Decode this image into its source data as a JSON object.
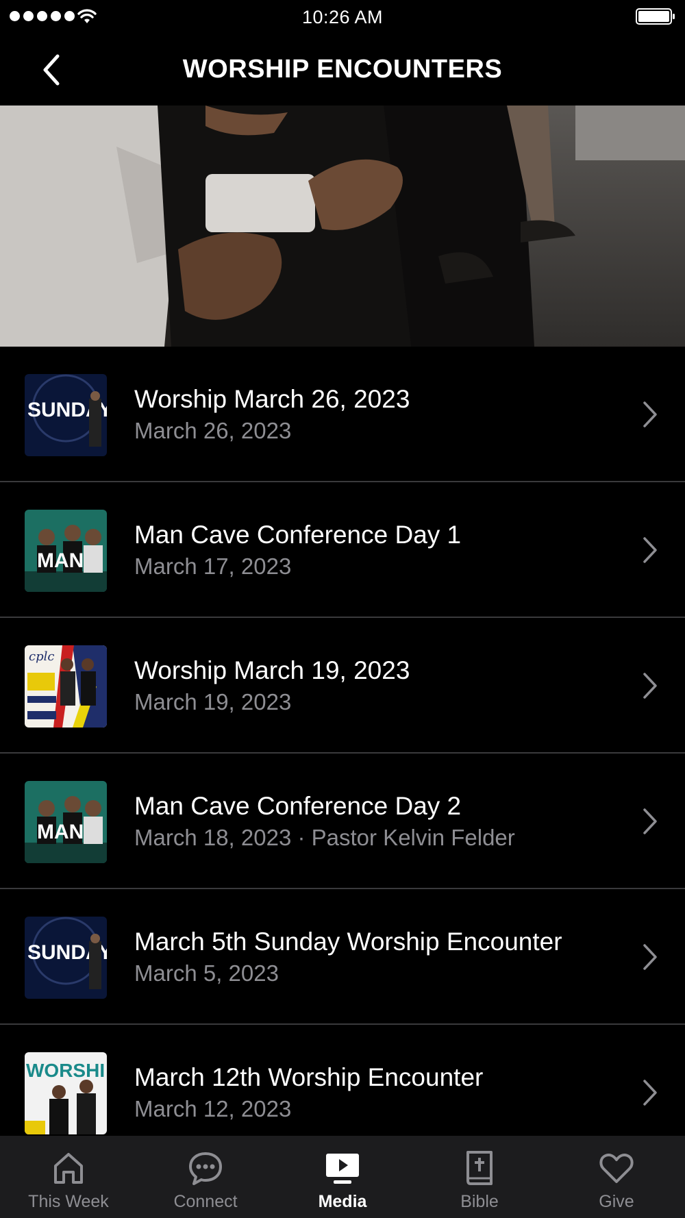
{
  "status_bar": {
    "time": "10:26 AM"
  },
  "nav": {
    "title": "WORSHIP ENCOUNTERS"
  },
  "items": [
    {
      "title": "Worship March 26, 2023",
      "subtitle": "March 26, 2023",
      "thumb_text": "SUNDAY"
    },
    {
      "title": "Man Cave Conference Day 1",
      "subtitle": "March 17, 2023",
      "thumb_text": "MAN"
    },
    {
      "title": "Worship March 19, 2023",
      "subtitle": "March 19, 2023",
      "thumb_text": "cplc"
    },
    {
      "title": "Man Cave Conference Day 2",
      "subtitle": "March 18, 2023 · Pastor Kelvin Felder",
      "thumb_text": "MAN"
    },
    {
      "title": "March 5th Sunday Worship Encounter",
      "subtitle": "March 5, 2023",
      "thumb_text": "SUNDAY"
    },
    {
      "title": "March 12th Worship Encounter",
      "subtitle": "March 12, 2023",
      "thumb_text": "WORSHI"
    }
  ],
  "tabs": [
    {
      "label": "This Week",
      "icon": "home-icon",
      "active": false
    },
    {
      "label": "Connect",
      "icon": "chat-bubble-icon",
      "active": false
    },
    {
      "label": "Media",
      "icon": "tv-play-icon",
      "active": true
    },
    {
      "label": "Bible",
      "icon": "bible-icon",
      "active": false
    },
    {
      "label": "Give",
      "icon": "heart-icon",
      "active": false
    }
  ],
  "colors": {
    "background": "#000000",
    "tab_bar": "#1c1c1e",
    "secondary_text": "#8e8e93",
    "separator": "#3a3a3c"
  }
}
